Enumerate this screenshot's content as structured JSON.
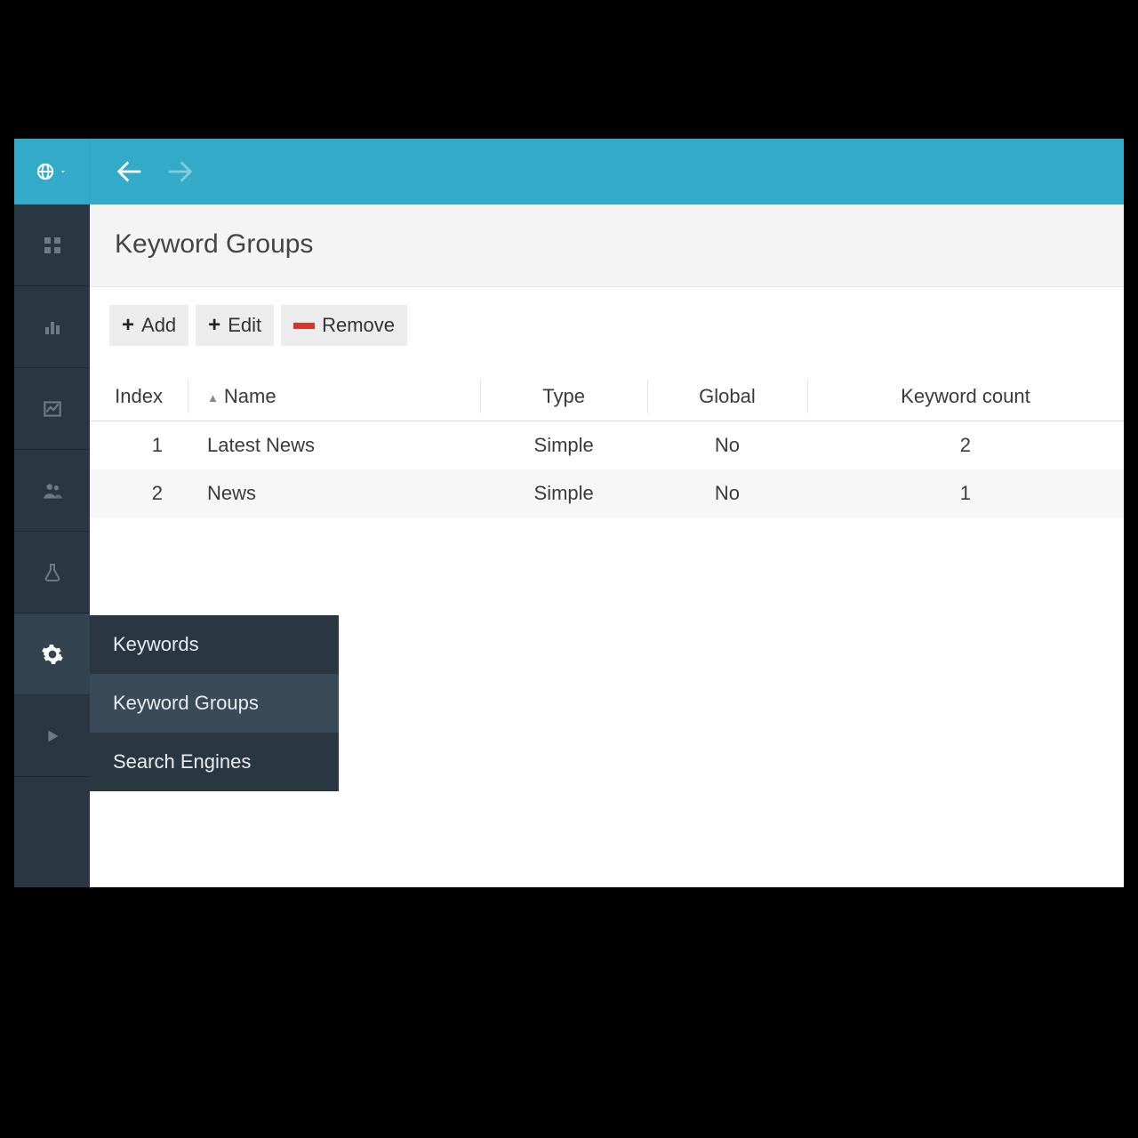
{
  "header": {
    "title": "Keyword Groups"
  },
  "toolbar": {
    "add_label": "Add",
    "edit_label": "Edit",
    "remove_label": "Remove"
  },
  "table": {
    "columns": {
      "index": "Index",
      "name": "Name",
      "type": "Type",
      "global": "Global",
      "count": "Keyword count"
    },
    "rows": [
      {
        "index": "1",
        "name": "Latest News",
        "type": "Simple",
        "global": "No",
        "count": "2"
      },
      {
        "index": "2",
        "name": "News",
        "type": "Simple",
        "global": "No",
        "count": "1"
      }
    ]
  },
  "flyout": {
    "items": [
      {
        "label": "Keywords"
      },
      {
        "label": "Keyword Groups"
      },
      {
        "label": "Search Engines"
      }
    ]
  },
  "sidebar": {
    "icons": [
      "dashboard",
      "bars",
      "linechart",
      "users",
      "flask",
      "gear",
      "play"
    ]
  }
}
